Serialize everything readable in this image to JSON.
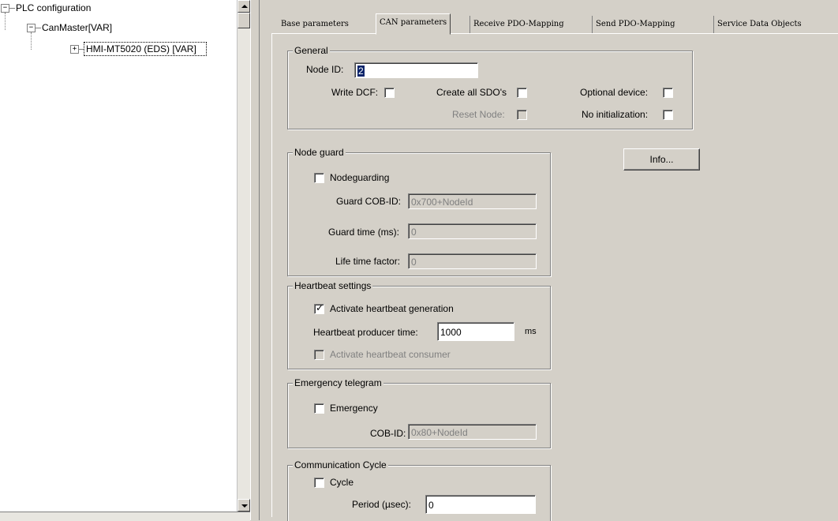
{
  "tree": {
    "root": "PLC configuration",
    "child": "CanMaster[VAR]",
    "leaf": "HMI-MT5020 (EDS)  [VAR]",
    "expand_minus": "−",
    "expand_plus": "+"
  },
  "tabs": [
    {
      "label": "Base parameters"
    },
    {
      "label": "CAN parameters"
    },
    {
      "label": "Receive PDO-Mapping"
    },
    {
      "label": "Send PDO-Mapping"
    },
    {
      "label": "Service Data Objects"
    }
  ],
  "general": {
    "title": "General",
    "node_id_label": "Node ID:",
    "node_id_value": "2",
    "write_dcf_label": "Write DCF:",
    "create_sdo_label": "Create all SDO's",
    "optional_device_label": "Optional device:",
    "reset_node_label": "Reset Node:",
    "no_init_label": "No initialization:"
  },
  "info_button": "Info...",
  "node_guard": {
    "title": "Node guard",
    "nodeguarding_label": "Nodeguarding",
    "cob_label": "Guard COB-ID:",
    "cob_value": "0x700+NodeId",
    "time_label": "Guard time (ms):",
    "time_value": "0",
    "life_label": "Life time factor:",
    "life_value": "0"
  },
  "heartbeat": {
    "title": "Heartbeat settings",
    "activate_label": "Activate heartbeat generation",
    "check_mark": "✓",
    "producer_label": "Heartbeat producer time:",
    "producer_value": "1000",
    "unit": "ms",
    "consumer_label": "Activate heartbeat consumer"
  },
  "emergency": {
    "title": "Emergency telegram",
    "check_label": "Emergency",
    "cob_label": "COB-ID:",
    "cob_value": "0x80+NodeId"
  },
  "comm_cycle": {
    "title": "Communication Cycle",
    "cycle_label": "Cycle",
    "period_label": "Period (µsec):",
    "period_value": "0"
  }
}
